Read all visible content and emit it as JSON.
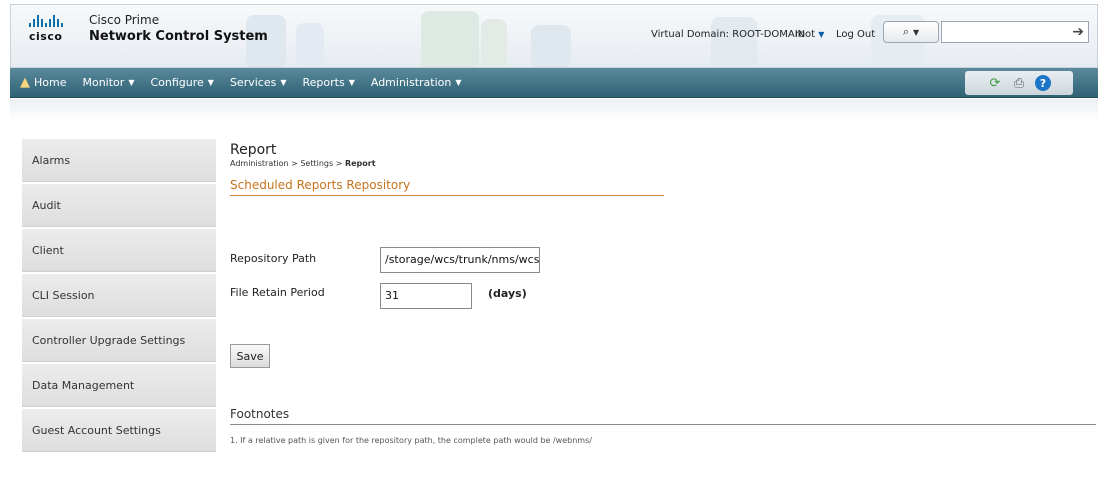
{
  "header": {
    "logo_text": "cisco",
    "brand_line1": "Cisco Prime",
    "brand_line2": "Network Control System",
    "virtual_domain": "Virtual Domain: ROOT-DOMAIN",
    "user": "root",
    "logout": "Log Out",
    "search_placeholder": ""
  },
  "nav": {
    "items": [
      {
        "label": "Home"
      },
      {
        "label": "Monitor"
      },
      {
        "label": "Configure"
      },
      {
        "label": "Services"
      },
      {
        "label": "Reports"
      },
      {
        "label": "Administration"
      }
    ]
  },
  "sidebar": {
    "items": [
      {
        "label": "Alarms"
      },
      {
        "label": "Audit"
      },
      {
        "label": "Client"
      },
      {
        "label": "CLI Session"
      },
      {
        "label": "Controller Upgrade Settings"
      },
      {
        "label": "Data Management"
      },
      {
        "label": "Guest Account Settings"
      }
    ]
  },
  "main": {
    "title": "Report",
    "breadcrumb_prefix": "Administration > Settings > ",
    "breadcrumb_current": "Report",
    "section_title": "Scheduled Reports Repository",
    "repository_label": "Repository Path",
    "repository_value": "/storage/wcs/trunk/nms/wcs-app",
    "retain_label": "File Retain Period",
    "retain_value": "31",
    "retain_unit": "(days)",
    "save_label": "Save",
    "footnotes_title": "Footnotes",
    "footnote_1": "1. If a relative path is given for the repository path, the complete path would be /webnms/"
  },
  "colors": {
    "nav_bg": "#3f7285",
    "section_accent": "#c57420"
  }
}
